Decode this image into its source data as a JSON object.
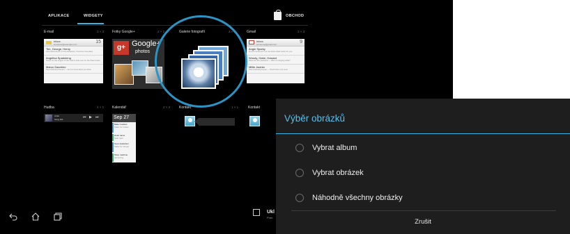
{
  "tabs": {
    "apps": "APLIKACE",
    "widgets": "WIDGETY"
  },
  "store": "OBCHOD",
  "accent": "#33b5e5",
  "widgets": [
    {
      "label": "E-mail",
      "size": "3 × 3"
    },
    {
      "label": "Fotky Google+",
      "size": "2 × 2"
    },
    {
      "label": "Galerie fotografií",
      "size": "2 × 2"
    },
    {
      "label": "Gmail",
      "size": "3 × 3"
    },
    {
      "label": "Hudba",
      "size": "4 × 1"
    },
    {
      "label": "Kalendář",
      "size": "2 × 3"
    },
    {
      "label": "Kontakt",
      "size": "1 × 1"
    },
    {
      "label": "Kontakt",
      "size": "1 × 1"
    }
  ],
  "email_preview": {
    "title": "Inbox",
    "subtitle": "someone@example.com",
    "count": "15",
    "rows": [
      {
        "from": "Tim, George, Henry",
        "snippet": "How about lunch on the weekend, I found a new place"
      },
      {
        "from": "Angelina Spadoleng",
        "snippet": "Notes for the engine of the mail to look over for the final review"
      },
      {
        "from": "Marco Zacchino",
        "snippet": "New Android phones! — let me know what you think"
      }
    ]
  },
  "gplus": {
    "badge": "g+",
    "title": "Google+",
    "sub": "photos"
  },
  "gmail_preview": {
    "title": "Inbox",
    "subtitle": "someone@gmail.com",
    "count": "9",
    "rows": [
      {
        "from": "Angie Sparky",
        "snippet": "Lunch tomorrow? Let me know what works for you"
      },
      {
        "from": "Woody, Gabe, Howard",
        "snippet": "Plans for the weekend — Who is bringing what?"
      },
      {
        "from": "Millie Jacinto",
        "snippet": "New Android phones — check them out soon"
      }
    ]
  },
  "music": {
    "track": "Artist",
    "sub": "Song title"
  },
  "calendar": {
    "date": "Sep 27",
    "events": [
      {
        "title": "Bake Cookies",
        "sub": "Make for Grace"
      },
      {
        "title": "Hotel name",
        "sub": "Start 3pm"
      },
      {
        "title": "Team Hackthon",
        "sub": "Make for Sergio"
      },
      {
        "title": "Shop machine",
        "sub": "upcoming"
      }
    ]
  },
  "notification": {
    "title": "Ukl",
    "sub": "Prah"
  },
  "dialog": {
    "title": "Výběr obrázků",
    "options": [
      "Vybrat album",
      "Vybrat obrázek",
      "Náhodně všechny obrázky"
    ],
    "cancel": "Zrušit"
  }
}
